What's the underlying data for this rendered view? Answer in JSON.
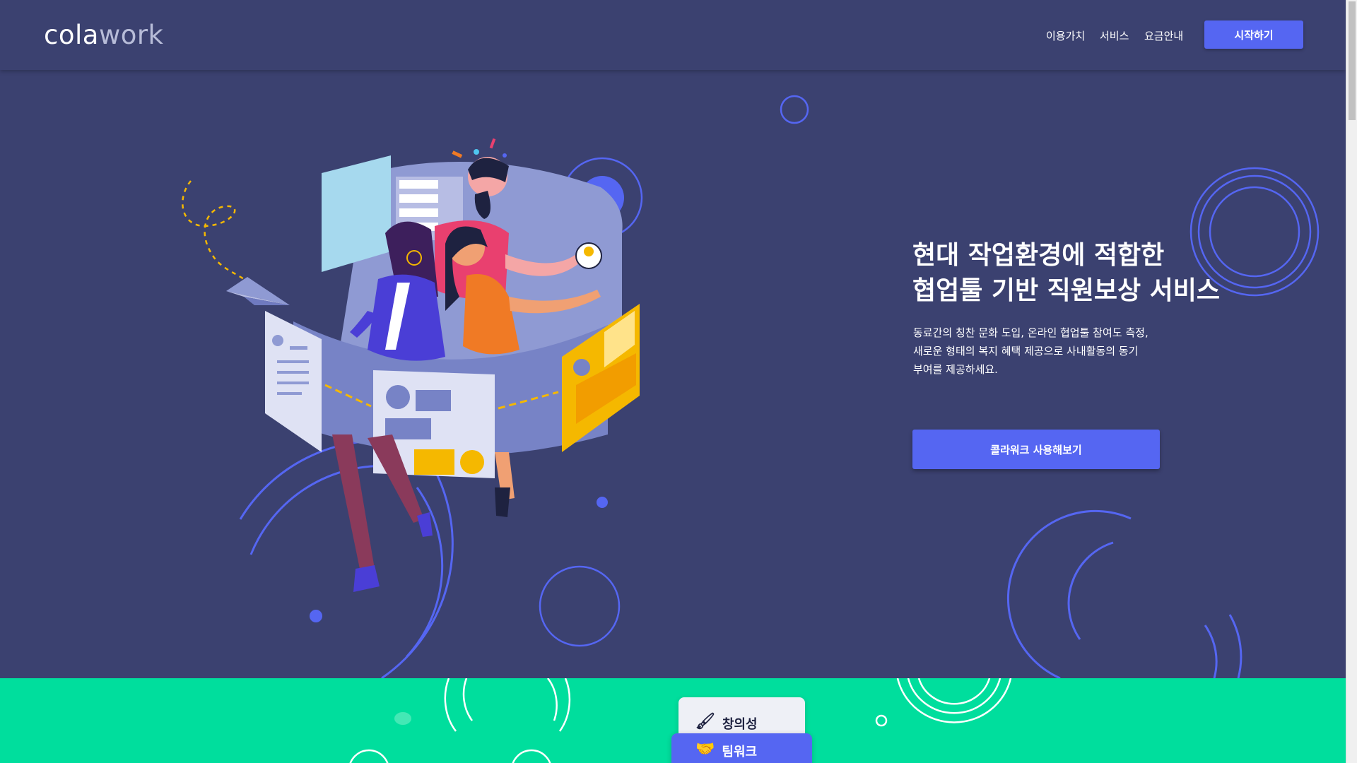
{
  "header": {
    "logo_cola": "cola",
    "logo_work": "work",
    "nav": [
      "이용가치",
      "서비스",
      "요금안내"
    ],
    "start_button": "시작하기"
  },
  "hero": {
    "title_lines": [
      "현대 작업환경에 적합한",
      "협업툴 기반 직원보상 서비스"
    ],
    "desc_lines": [
      "동료간의 칭찬 문화 도입, 온라인 협업툴 참여도 측정,",
      "새로운 형태의 복지 혜택 제공으로 사내활동의 동기",
      "부여를 제공하세요."
    ],
    "cta_button": "콜라워크 사용해보기"
  },
  "values": {
    "items": [
      {
        "icon": "paintbrush-icon",
        "glyph": "🖌",
        "label": "창의성"
      },
      {
        "icon": "handshake-icon",
        "glyph": "🤝",
        "label": "팀워크"
      }
    ]
  },
  "colors": {
    "background": "#3b4170",
    "accent": "#5566f2",
    "band": "#00de9d"
  }
}
